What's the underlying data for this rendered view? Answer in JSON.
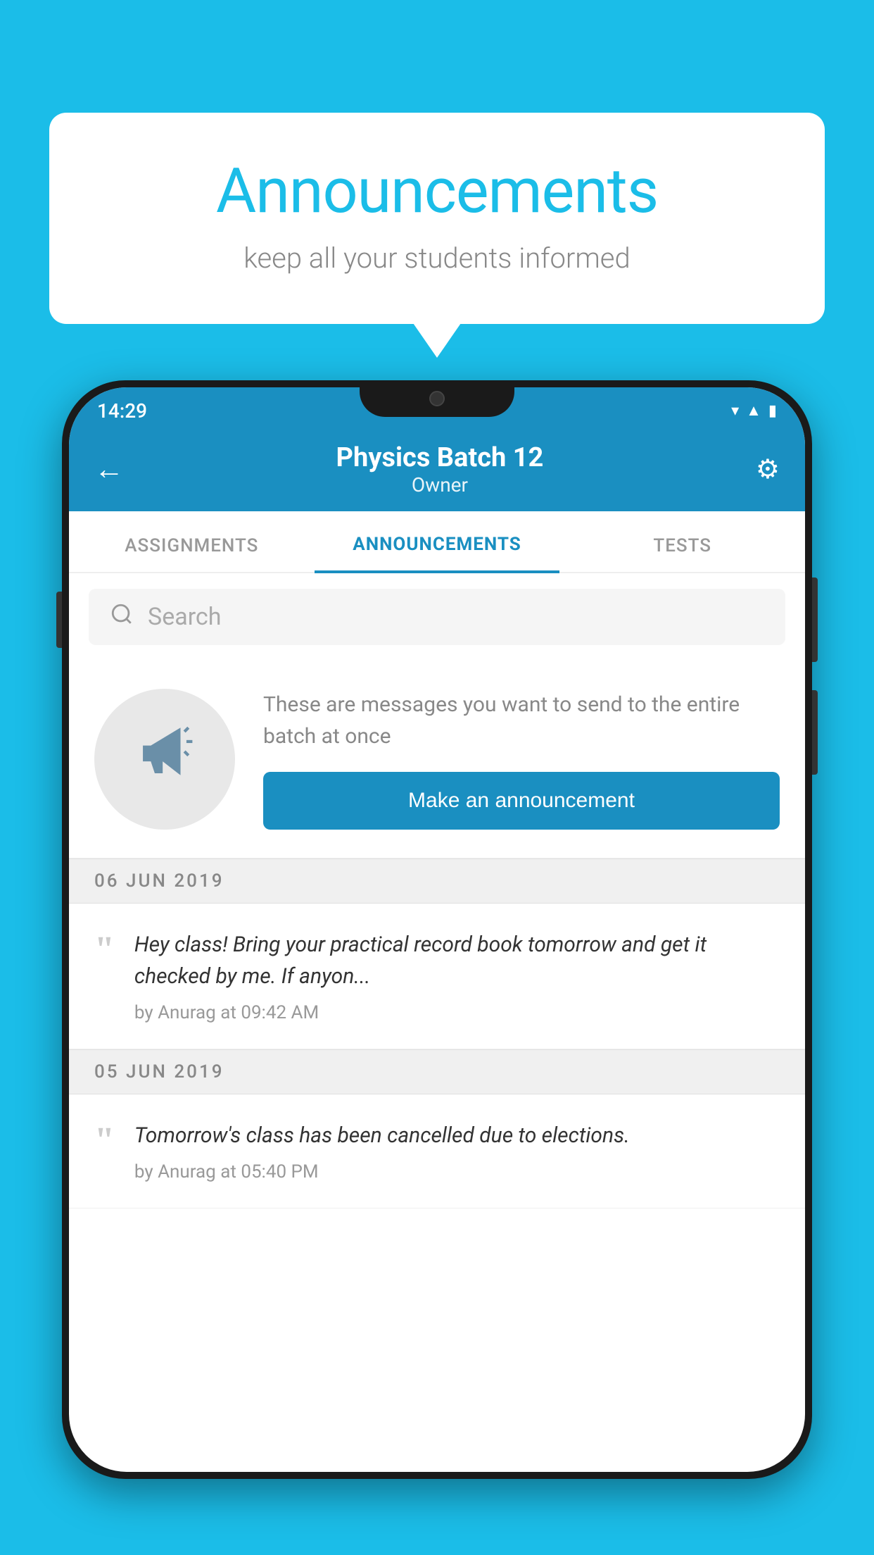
{
  "bubble": {
    "title": "Announcements",
    "subtitle": "keep all your students informed"
  },
  "phone": {
    "statusBar": {
      "time": "14:29"
    },
    "header": {
      "title": "Physics Batch 12",
      "subtitle": "Owner"
    },
    "tabs": [
      {
        "label": "ASSIGNMENTS",
        "active": false
      },
      {
        "label": "ANNOUNCEMENTS",
        "active": true
      },
      {
        "label": "TESTS",
        "active": false
      }
    ],
    "search": {
      "placeholder": "Search"
    },
    "announcementPrompt": {
      "description": "These are messages you want to send to the entire batch at once",
      "buttonLabel": "Make an announcement"
    },
    "announcements": [
      {
        "date": "06  JUN  2019",
        "text": "Hey class! Bring your practical record book tomorrow and get it checked by me. If anyon...",
        "meta": "by Anurag at 09:42 AM"
      },
      {
        "date": "05  JUN  2019",
        "text": "Tomorrow's class has been cancelled due to elections.",
        "meta": "by Anurag at 05:40 PM"
      }
    ]
  }
}
